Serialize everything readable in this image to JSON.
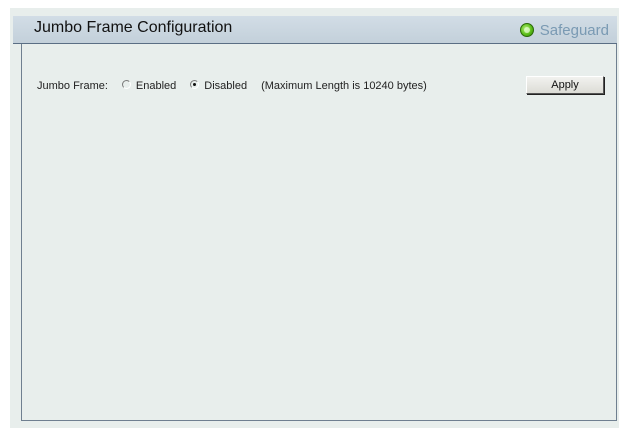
{
  "header": {
    "title": "Jumbo Frame Configuration",
    "safeguard_label": "Safeguard",
    "safeguard_icon": "status-dot-icon",
    "safeguard_color": "#5cbf1a"
  },
  "jumbo_frame": {
    "label": "Jumbo Frame:",
    "options": [
      {
        "label": "Enabled",
        "checked": false
      },
      {
        "label": "Disabled",
        "checked": true
      }
    ],
    "note": "(Maximum Length is 10240 bytes)"
  },
  "actions": {
    "apply_label": "Apply"
  }
}
